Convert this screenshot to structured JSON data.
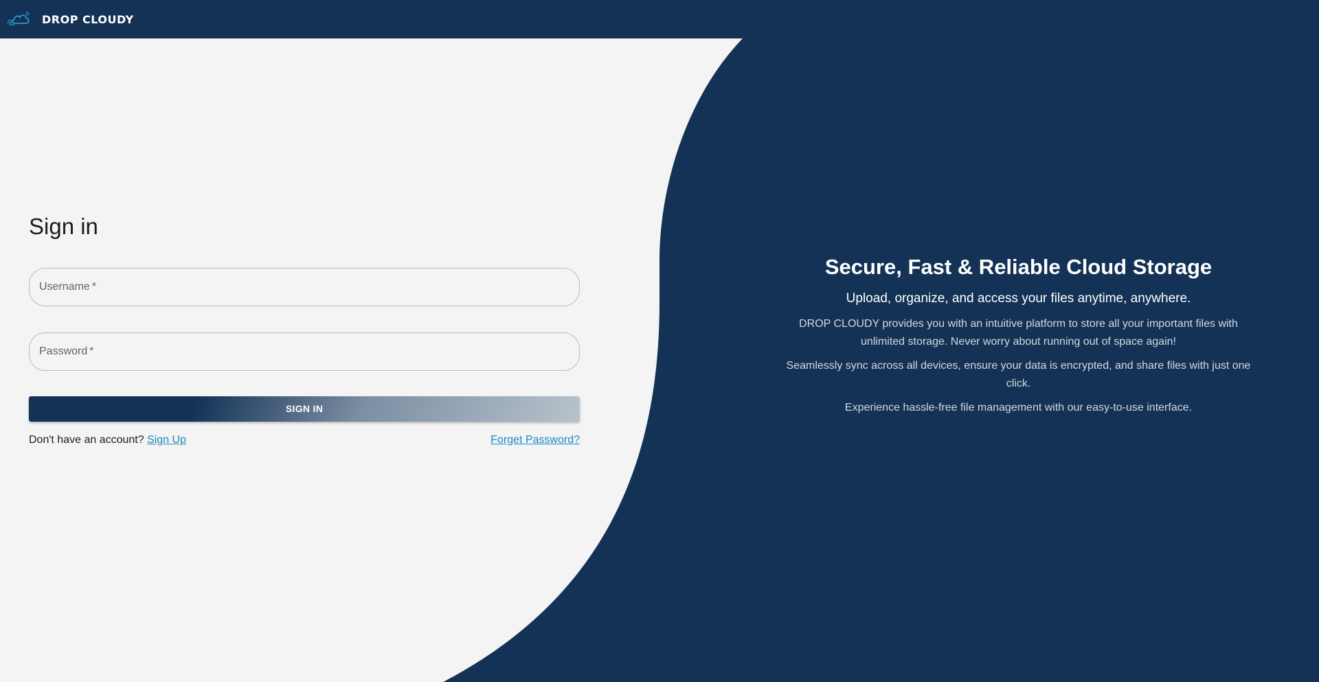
{
  "header": {
    "brand": "DROP CLOUDY",
    "logo_icon": "cloud-logo-icon"
  },
  "form": {
    "title": "Sign in",
    "username": {
      "label": "Username",
      "required_mark": "*",
      "value": ""
    },
    "password": {
      "label": "Password",
      "required_mark": "*",
      "value": ""
    },
    "submit_label": "SIGN IN",
    "no_account_text": "Don't have an account?",
    "signup_label": "Sign Up",
    "forgot_label": "Forget Password?"
  },
  "hero": {
    "title": "Secure, Fast & Reliable Cloud Storage",
    "subtitle": "Upload, organize, and access your files anytime, anywhere.",
    "paragraphs": [
      "DROP CLOUDY provides you with an intuitive platform to store all your important files with unlimited storage. Never worry about running out of space again!",
      "Seamlessly sync across all devices, ensure your data is encrypted, and share files with just one click.",
      "Experience hassle-free file management with our easy-to-use interface."
    ]
  },
  "colors": {
    "navy": "#133256",
    "background": "#f3f4f3",
    "link": "#1a8ac1"
  }
}
